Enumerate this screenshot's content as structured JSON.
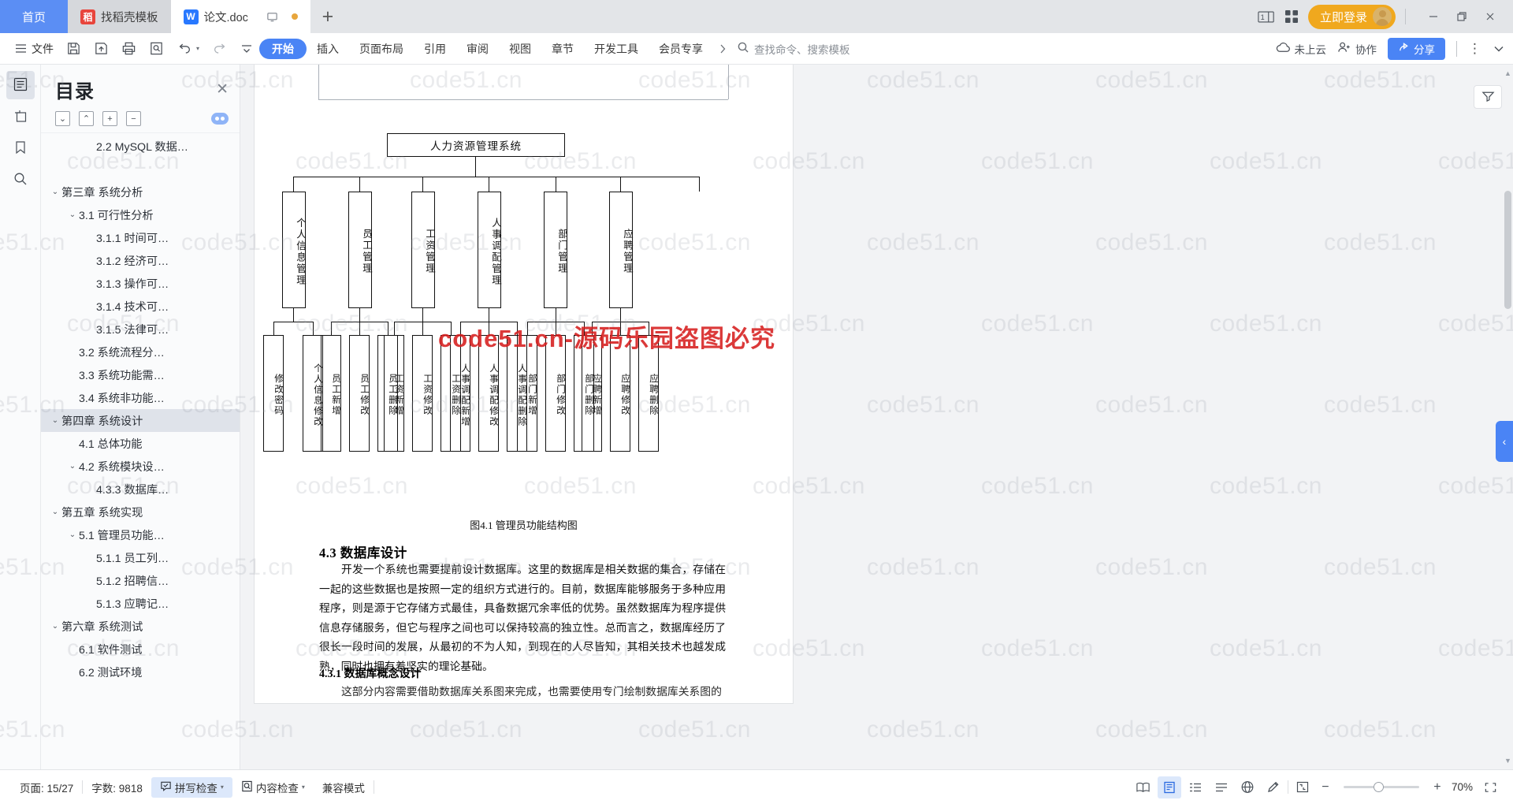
{
  "window": {
    "tabs": [
      {
        "label": "首页",
        "icon": "home-tab",
        "state": "home"
      },
      {
        "label": "找稻壳模板",
        "icon": "docer-icon",
        "state": "inactive"
      },
      {
        "label": "论文.doc",
        "icon": "word-icon",
        "state": "active"
      }
    ],
    "new_tab_label": "+",
    "login_label": "立即登录",
    "minimize_label": "—",
    "restore_label": "❐",
    "close_label": "✕"
  },
  "ribbon": {
    "file_label": "文件",
    "tabs": [
      {
        "label": "开始",
        "active": true
      },
      {
        "label": "插入",
        "active": false
      },
      {
        "label": "页面布局",
        "active": false
      },
      {
        "label": "引用",
        "active": false
      },
      {
        "label": "审阅",
        "active": false
      },
      {
        "label": "视图",
        "active": false
      },
      {
        "label": "章节",
        "active": false
      },
      {
        "label": "开发工具",
        "active": false
      },
      {
        "label": "会员专享",
        "active": false
      }
    ],
    "search_placeholder": "查找命令、搜索模板",
    "cloud_status": "未上云",
    "collab_label": "协作",
    "share_label": "分享",
    "more_label": "⋮"
  },
  "toc": {
    "title": "目录",
    "close_label": "✕",
    "tools": [
      {
        "name": "expand-down-button",
        "glyph": "⌄"
      },
      {
        "name": "collapse-up-button",
        "glyph": "⌃"
      },
      {
        "name": "expand-all-button",
        "glyph": "+"
      },
      {
        "name": "collapse-all-button",
        "glyph": "−"
      }
    ],
    "items": [
      {
        "label": "2.2 MySQL 数据…",
        "indent": 2,
        "chevron": "",
        "selected": false
      },
      {
        "label": "",
        "indent": 0,
        "chevron": "",
        "selected": false
      },
      {
        "label": "第三章  系统分析",
        "indent": 0,
        "chevron": "⌄",
        "selected": false
      },
      {
        "label": "3.1 可行性分析",
        "indent": 1,
        "chevron": "⌄",
        "selected": false
      },
      {
        "label": "3.1.1 时间可…",
        "indent": 2,
        "chevron": "",
        "selected": false
      },
      {
        "label": "3.1.2 经济可…",
        "indent": 2,
        "chevron": "",
        "selected": false
      },
      {
        "label": "3.1.3 操作可…",
        "indent": 2,
        "chevron": "",
        "selected": false
      },
      {
        "label": "3.1.4 技术可…",
        "indent": 2,
        "chevron": "",
        "selected": false
      },
      {
        "label": "3.1.5 法律可…",
        "indent": 2,
        "chevron": "",
        "selected": false
      },
      {
        "label": "3.2 系统流程分…",
        "indent": 1,
        "chevron": "",
        "selected": false
      },
      {
        "label": "3.3 系统功能需…",
        "indent": 1,
        "chevron": "",
        "selected": false
      },
      {
        "label": "3.4 系统非功能…",
        "indent": 1,
        "chevron": "",
        "selected": false
      },
      {
        "label": "第四章  系统设计",
        "indent": 0,
        "chevron": "⌄",
        "selected": true
      },
      {
        "label": "4.1 总体功能",
        "indent": 1,
        "chevron": "",
        "selected": false
      },
      {
        "label": "4.2 系统模块设…",
        "indent": 1,
        "chevron": "⌄",
        "selected": false
      },
      {
        "label": "4.3.3 数据库…",
        "indent": 2,
        "chevron": "",
        "selected": false
      },
      {
        "label": "第五章  系统实现",
        "indent": 0,
        "chevron": "⌄",
        "selected": false
      },
      {
        "label": "5.1 管理员功能…",
        "indent": 1,
        "chevron": "⌄",
        "selected": false
      },
      {
        "label": "5.1.1 员工列…",
        "indent": 2,
        "chevron": "",
        "selected": false
      },
      {
        "label": "5.1.2 招聘信…",
        "indent": 2,
        "chevron": "",
        "selected": false
      },
      {
        "label": "5.1.3 应聘记…",
        "indent": 2,
        "chevron": "",
        "selected": false
      },
      {
        "label": "第六章  系统测试",
        "indent": 0,
        "chevron": "⌄",
        "selected": false
      },
      {
        "label": "6.1 软件测试",
        "indent": 1,
        "chevron": "",
        "selected": false
      },
      {
        "label": "6.2 测试环境",
        "indent": 1,
        "chevron": "",
        "selected": false
      }
    ]
  },
  "document": {
    "diagram": {
      "root": "人力资源管理系统",
      "level1": [
        "个人信息管理",
        "员工管理",
        "工资管理",
        "人事调配管理",
        "部门管理",
        "应聘管理"
      ],
      "level2": [
        "修改密码",
        "个人信息修改",
        "员工新增",
        "员工修改",
        "员工删除",
        "工资新增",
        "工资修改",
        "工资删除",
        "人事调配新增",
        "人事调配修改",
        "人事调配删除",
        "部门新增",
        "部门修改",
        "部门删除",
        "应聘新增",
        "应聘修改",
        "应聘删除"
      ]
    },
    "caption": "图4.1 管理员功能结构图",
    "heading_43": "4.3  数据库设计",
    "para_43": "开发一个系统也需要提前设计数据库。这里的数据库是相关数据的集合，存储在一起的这些数据也是按照一定的组织方式进行的。目前，数据库能够服务于多种应用程序，则是源于它存储方式最佳，具备数据冗余率低的优势。虽然数据库为程序提供信息存储服务，但它与程序之间也可以保持较高的独立性。总而言之，数据库经历了很长一段时间的发展，从最初的不为人知，到现在的人尽皆知，其相关技术也越发成熟，同时也拥有着坚实的理论基础。",
    "heading_431": "4.3.1  数据库概念设计",
    "para_431": "这部分内容需要借助数据库关系图来完成，也需要使用专门绘制数据库关系图的"
  },
  "status": {
    "page_label": "页面: 15/27",
    "words_label": "字数: 9818",
    "spellcheck_label": "拼写检查",
    "contentcheck_label": "内容检查",
    "compat_label": "兼容模式",
    "zoom_label": "70%",
    "zoom_out": "−",
    "zoom_in": "+",
    "fullscreen_label": "⛶"
  },
  "watermarks": {
    "gray_text": "code51.cn",
    "red_text": "code51.cn-源码乐园盗图必究"
  },
  "colors": {
    "accent_blue": "#4a84f5",
    "login_orange": "#f0a81e",
    "tab_home": "#5b8ef4",
    "watermark_red": "#d61e1e"
  }
}
